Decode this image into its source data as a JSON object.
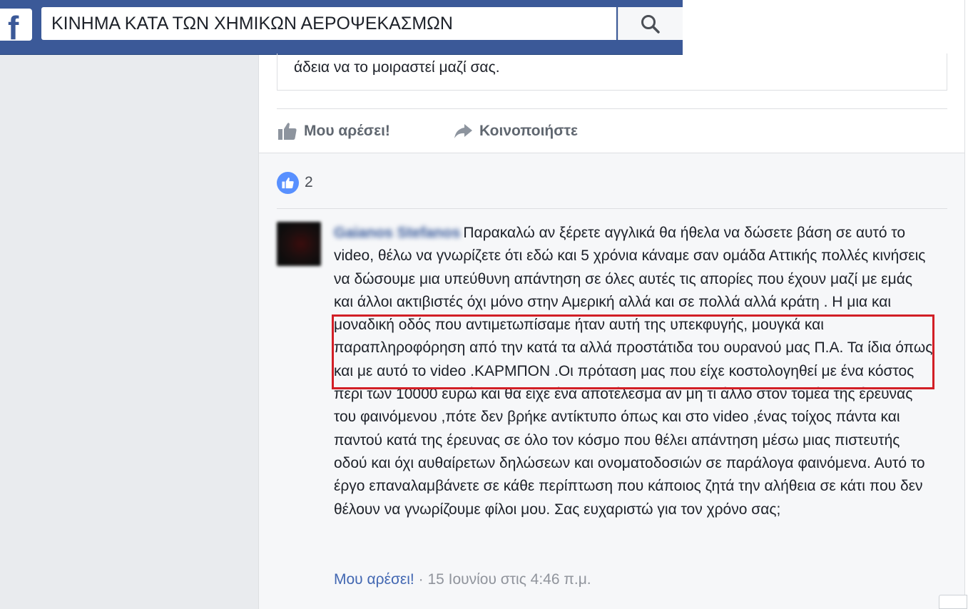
{
  "topbar": {
    "logo_letter": "f",
    "search_value": "ΚΙΝΗΜΑ ΚΑΤΑ ΤΩΝ ΧΗΜΙΚΩΝ ΑΕΡΟΨΕΚΑΣΜΩΝ",
    "brand_color": "#3b5998",
    "search_icon": "magnifier-icon"
  },
  "post": {
    "attachment_text": "άδεια να το μοιραστεί μαζί σας.",
    "actions": {
      "like_label": "Μου αρέσει!",
      "share_label": "Κοινοποιήστε"
    },
    "reactions": {
      "icon": "thumbs-up-icon",
      "count": "2"
    }
  },
  "comment": {
    "author": "Gaianos Stefanos",
    "text": "Παρακαλώ αν ξέρετε αγγλικά θα ήθελα να δώσετε βάση σε αυτό το video, θέλω να γνωρίζετε ότι εδώ και 5 χρόνια κάναμε σαν ομάδα Αττικής πολλές κινήσεις να δώσουμε μια υπεύθυνη απάντηση σε όλες αυτές τις απορίες που έχουν μαζί με εμάς και άλλοι ακτιβιστές όχι μόνο στην Αμερική αλλά και σε πολλά αλλά κράτη . Η μια και μοναδική οδός που αντιμετωπίσαμε ήταν αυτή της υπεκφυγής, μουγκά και παραπληροφόρηση από την κατά τα αλλά προστάτιδα του ουρανού μας Π.Α. Τα ίδια όπως και με αυτό το video .ΚΑΡΜΠΟΝ .Οι πρόταση μας που είχε κοστολογηθεί με ένα κόστος περί των 10000 ευρώ και θα είχε ένα αποτέλεσμα αν μη τι άλλο στον τομέα της έρευνας του φαινόμενου ,πότε δεν βρήκε αντίκτυπο όπως και στο video ,ένας τοίχος πάντα και παντού κατά της έρευνας σε όλο τον κόσμο που θέλει απάντηση μέσω μιας πιστευτής οδού και όχι αυθαίρετων δηλώσεων και ονοματοδοσιών σε παράλογα φαινόμενα. Αυτό το έργο επαναλαμβάνετε σε κάθε περίπτωση που κάποιος ζητά την αλήθεια σε κάτι που δεν θέλουν να γνωρίζουμε φίλοι μου. Σας ευχαριστώ για τον χρόνο σας;",
    "like_link": "Μου αρέσει!",
    "separator": " · ",
    "timestamp": "15 Ιουνίου στις 4:46 π.μ.",
    "highlight_color": "#d21f26"
  }
}
